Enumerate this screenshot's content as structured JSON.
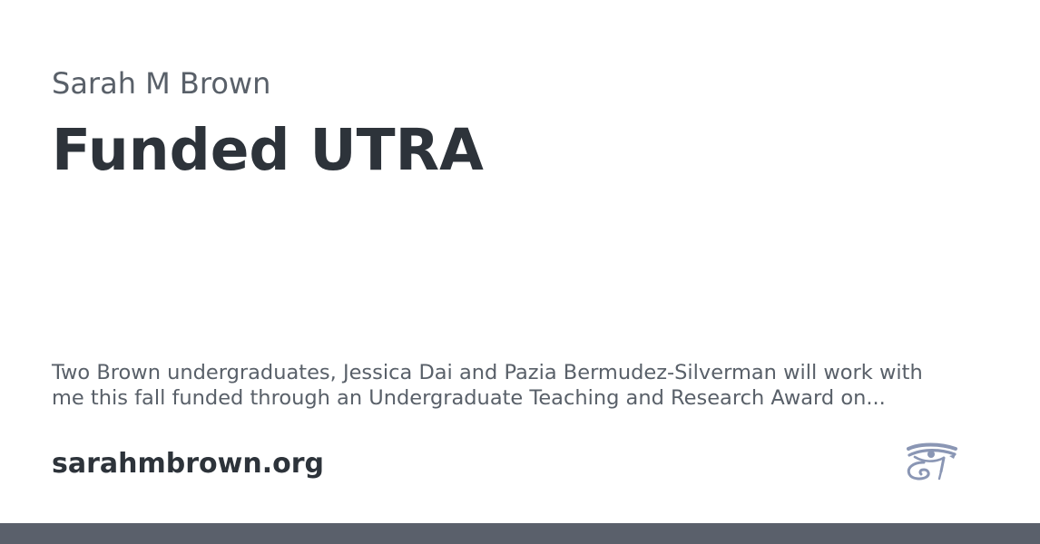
{
  "author": "Sarah M Brown",
  "title": "Funded UTRA",
  "description": "Two Brown undergraduates, Jessica Dai and Pazia Bermudez-Silverman will work with me this fall funded through an Undergraduate Teaching and Research Award on...",
  "domain": "sarahmbrown.org",
  "logo_icon": "eye-of-horus-icon",
  "colors": {
    "heading": "#2d333a",
    "muted_text": "#596069",
    "logo": "#8a96b4",
    "footer_bar": "#5a606b",
    "background": "#ffffff"
  }
}
